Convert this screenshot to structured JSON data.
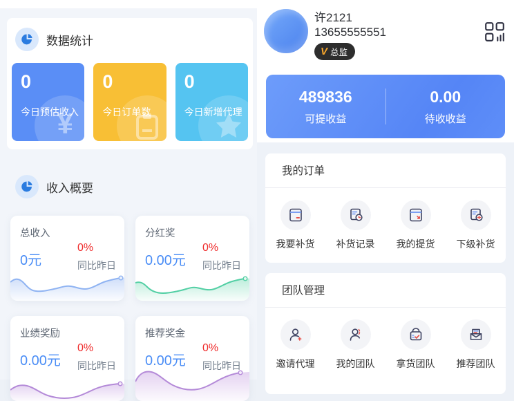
{
  "theme": {
    "primary_blue": "#5a8ef6",
    "yellow": "#f8bf35",
    "cyan": "#55c4f1",
    "red": "#ef2b2b",
    "value_blue": "#4a8df6",
    "badge_bg": "#2d2d2d",
    "badge_orange": "#f7a62c"
  },
  "left": {
    "stats": {
      "title": "数据统计",
      "cards": [
        {
          "value": "0",
          "label": "今日预估收入",
          "color": "#5a8ef6",
          "icon": "yen-coin-icon"
        },
        {
          "value": "0",
          "label": "今日订单数",
          "color": "#f8bf35",
          "icon": "clipboard-icon"
        },
        {
          "value": "0",
          "label": "今日新增代理",
          "color": "#55c4f1",
          "icon": "star-icon"
        }
      ]
    },
    "income": {
      "title": "收入概要",
      "cards": [
        {
          "title": "总收入",
          "value": "0元",
          "percent": "0%",
          "compare": "同比昨日",
          "line_color": "#8fb3f2"
        },
        {
          "title": "分红奖",
          "value": "0.00元",
          "percent": "0%",
          "compare": "同比昨日",
          "line_color": "#52cfa4"
        },
        {
          "title": "业绩奖励",
          "value": "0.00元",
          "percent": "0%",
          "compare": "同比昨日",
          "line_color": "#b48ad8"
        },
        {
          "title": "推荐奖金",
          "value": "0.00元",
          "percent": "0%",
          "compare": "同比昨日",
          "line_color": "#b48ad8"
        }
      ]
    }
  },
  "right": {
    "profile": {
      "name": "许2121",
      "phone": "13655555551",
      "badge_v": "V",
      "badge_label": "总监",
      "corner_icon": "dashboard-grid-icon"
    },
    "wallet": {
      "left_value": "489836",
      "left_label": "可提收益",
      "right_value": "0.00",
      "right_label": "待收收益"
    },
    "orders": {
      "title": "我的订单",
      "items": [
        {
          "label": "我要补货",
          "icon": "restock-doc-icon"
        },
        {
          "label": "补货记录",
          "icon": "restock-record-icon"
        },
        {
          "label": "我的提货",
          "icon": "pickup-doc-icon"
        },
        {
          "label": "下级补货",
          "icon": "sub-restock-icon"
        }
      ]
    },
    "team": {
      "title": "团队管理",
      "items": [
        {
          "label": "邀请代理",
          "icon": "invite-agent-icon"
        },
        {
          "label": "我的团队",
          "icon": "my-team-icon"
        },
        {
          "label": "拿货团队",
          "icon": "goods-team-icon"
        },
        {
          "label": "推荐团队",
          "icon": "referral-team-icon"
        }
      ]
    }
  }
}
